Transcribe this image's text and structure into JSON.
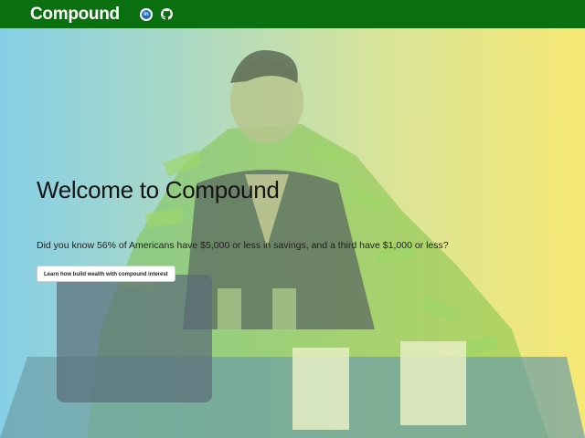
{
  "nav": {
    "brand": "Compound",
    "linkedin_icon": "linkedin-icon",
    "linkedin_text": "in",
    "github_icon": "github-icon"
  },
  "hero": {
    "title": "Welcome to Compound",
    "description": "Did you know 56% of Americans have $5,000 or less in savings, and a third have $1,000 or less?",
    "cta_label": "Learn how build wealth with compound interest"
  },
  "colors": {
    "navbar": "#0a6f0f",
    "gradient_left": "#86cfe6",
    "gradient_right": "#f6e873",
    "money": "#7fc24a"
  }
}
